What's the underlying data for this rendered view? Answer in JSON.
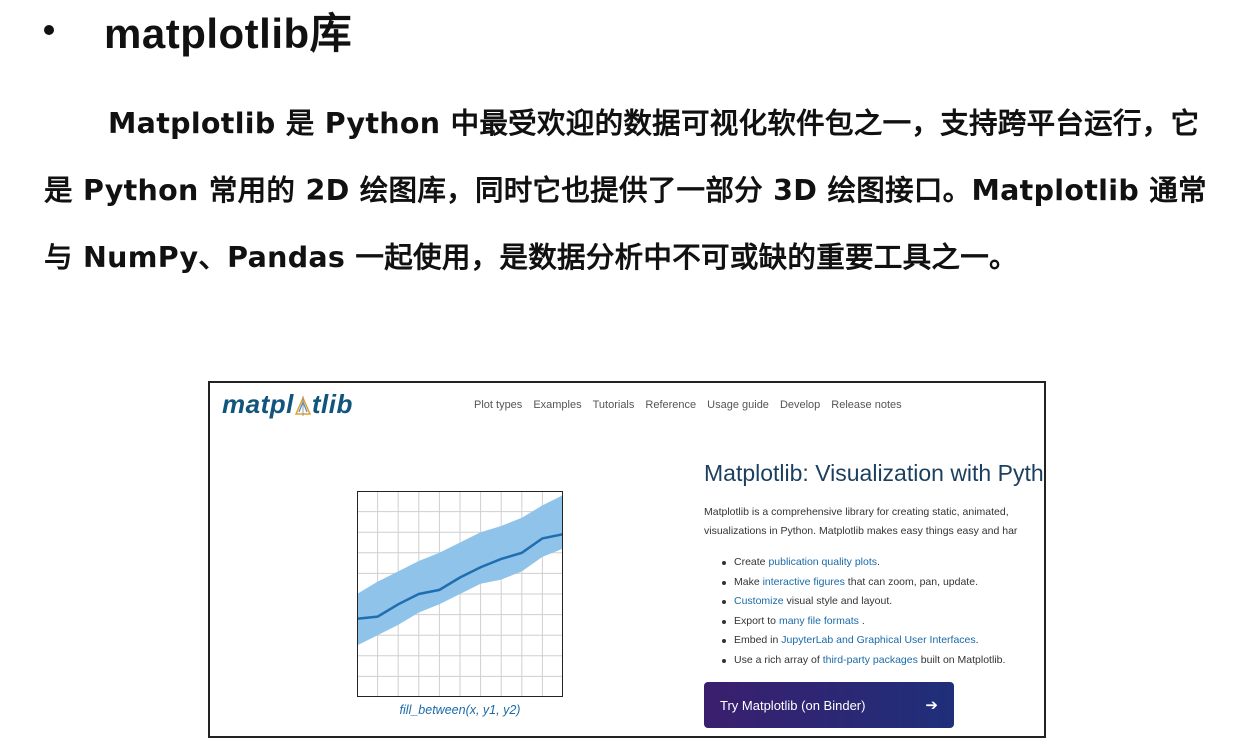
{
  "slide": {
    "bullet_title": "matplotlib库",
    "paragraph": "Matplotlib 是 Python 中最受欢迎的数据可视化软件包之一，支持跨平台运行，它是 Python 常用的 2D 绘图库，同时它也提供了一部分 3D 绘图接口。Matplotlib 通常与 NumPy、Pandas 一起使用，是数据分析中不可或缺的重要工具之一。"
  },
  "site": {
    "logo_left": "matpl",
    "logo_right": "tlib",
    "nav": [
      "Plot types",
      "Examples",
      "Tutorials",
      "Reference",
      "Usage guide",
      "Develop",
      "Release notes"
    ],
    "hero_title": "Matplotlib: Visualization with Pyth",
    "desc_line1": "Matplotlib is a comprehensive library for creating static, animated,",
    "desc_line2": "visualizations in Python. Matplotlib makes easy things easy and har",
    "features": [
      {
        "pre": "Create ",
        "link": "publication quality plots",
        "post": "."
      },
      {
        "pre": "Make ",
        "link": "interactive figures",
        "post": " that can zoom, pan, update."
      },
      {
        "pre": "",
        "link": "Customize",
        "post": " visual style and layout."
      },
      {
        "pre": "Export to ",
        "link": "many file formats",
        "post": " ."
      },
      {
        "pre": "Embed in ",
        "link": "JupyterLab and Graphical User Interfaces",
        "post": "."
      },
      {
        "pre": "Use a rich array of ",
        "link": "third-party packages",
        "post": " built on Matplotlib."
      }
    ],
    "button_label": "Try Matplotlib (on Binder)",
    "arrow": "➔",
    "plot_caption": "fill_between(x, y1, y2)"
  },
  "colors": {
    "logo": "#11557c",
    "band_fill": "#8fc3ea",
    "line": "#1f6fb0",
    "button": "#2a2472"
  },
  "chart_data": {
    "type": "area",
    "x": [
      0,
      1,
      2,
      3,
      4,
      5,
      6,
      7,
      8,
      9,
      10
    ],
    "series": [
      {
        "values": [
          2.5,
          3.0,
          3.5,
          4.1,
          4.5,
          5.0,
          5.5,
          5.7,
          6.1,
          6.8,
          7.2
        ]
      },
      {
        "values": [
          5.0,
          5.6,
          6.1,
          6.6,
          7.0,
          7.5,
          8.0,
          8.3,
          8.7,
          9.3,
          9.8
        ]
      },
      {
        "values": [
          3.8,
          3.9,
          4.5,
          5.0,
          5.2,
          5.8,
          6.3,
          6.7,
          7.0,
          7.7,
          7.9
        ]
      }
    ],
    "xlim": [
      0,
      10
    ],
    "ylim": [
      0,
      10
    ],
    "grid": true
  }
}
